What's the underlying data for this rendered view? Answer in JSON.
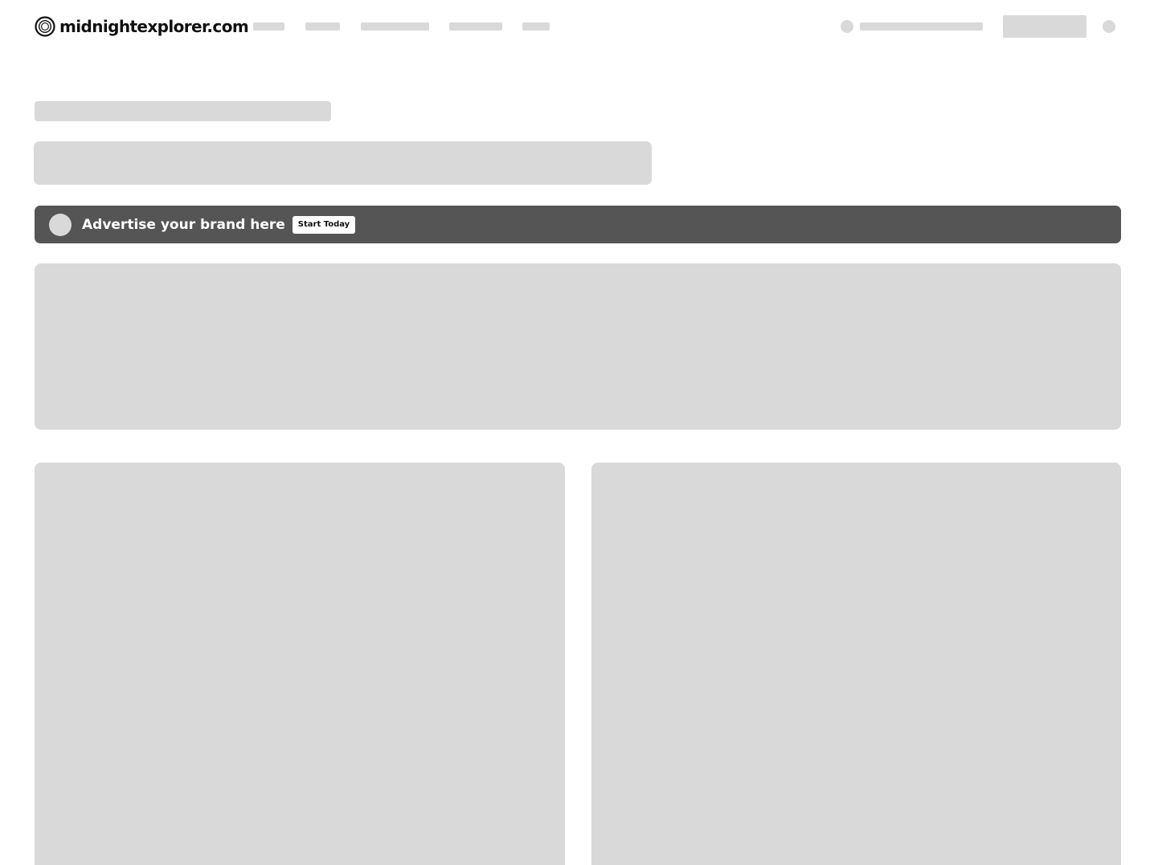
{
  "site": {
    "name": "midnightexplorer.com",
    "logo_icon": "concentric-circles-icon"
  },
  "loading_state": "skeleton",
  "ad_banner": {
    "text": "Advertise your brand here",
    "button_label": "Start Today",
    "background_color": "#555555"
  },
  "colors": {
    "skeleton": "#d9d9d9",
    "text": "#111111",
    "background": "#ffffff"
  }
}
